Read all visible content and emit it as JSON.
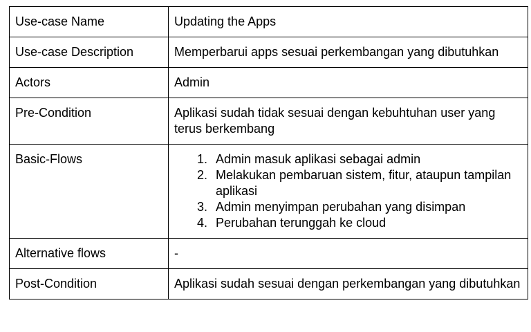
{
  "rows": [
    {
      "label": "Use-case Name",
      "value": "Updating the Apps"
    },
    {
      "label": "Use-case Description",
      "value": "Memperbarui apps sesuai perkembangan yang dibutuhkan"
    },
    {
      "label": "Actors",
      "value": "Admin"
    },
    {
      "label": "Pre-Condition",
      "value": "Aplikasi sudah tidak sesuai dengan kebuhtuhan user yang terus berkembang"
    },
    {
      "label": "Basic-Flows",
      "steps": [
        {
          "num": "1.",
          "text": "Admin masuk aplikasi sebagai admin"
        },
        {
          "num": "2.",
          "text": "Melakukan pembaruan sistem, fitur, ataupun tampilan aplikasi"
        },
        {
          "num": "3.",
          "text": "Admin menyimpan perubahan yang disimpan"
        },
        {
          "num": "4.",
          "text": "Perubahan terunggah ke cloud"
        }
      ]
    },
    {
      "label": "Alternative flows",
      "value": "-"
    },
    {
      "label": "Post-Condition",
      "value": "Aplikasi sudah sesuai dengan perkembangan yang dibutuhkan"
    }
  ]
}
